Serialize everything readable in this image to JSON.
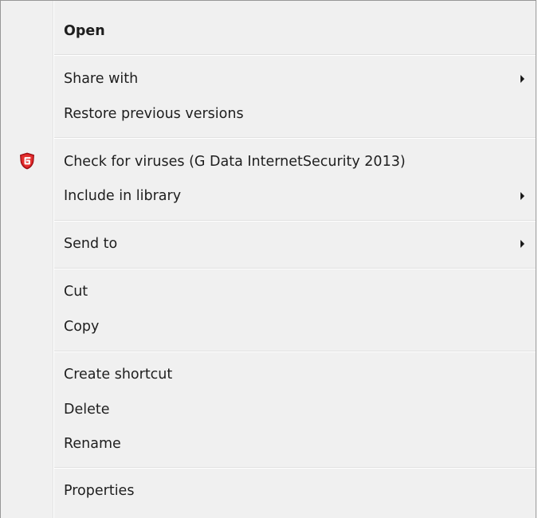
{
  "menu": {
    "items": [
      {
        "label": "Open",
        "bold": true,
        "submenu": false
      },
      {
        "label": "Share with",
        "submenu": true
      },
      {
        "label": "Restore previous versions",
        "submenu": false
      },
      {
        "label": "Check for viruses (G Data InternetSecurity 2013)",
        "submenu": false,
        "icon": "gdata-shield-icon"
      },
      {
        "label": "Include in library",
        "submenu": true
      },
      {
        "label": "Send to",
        "submenu": true
      },
      {
        "label": "Cut",
        "submenu": false
      },
      {
        "label": "Copy",
        "submenu": false
      },
      {
        "label": "Create shortcut",
        "submenu": false
      },
      {
        "label": "Delete",
        "submenu": false
      },
      {
        "label": "Rename",
        "submenu": false
      },
      {
        "label": "Properties",
        "submenu": false
      }
    ]
  },
  "colors": {
    "background": "#f0f0f0",
    "border": "#979797",
    "text": "#1e1e1e",
    "icon_red": "#d9232a"
  }
}
